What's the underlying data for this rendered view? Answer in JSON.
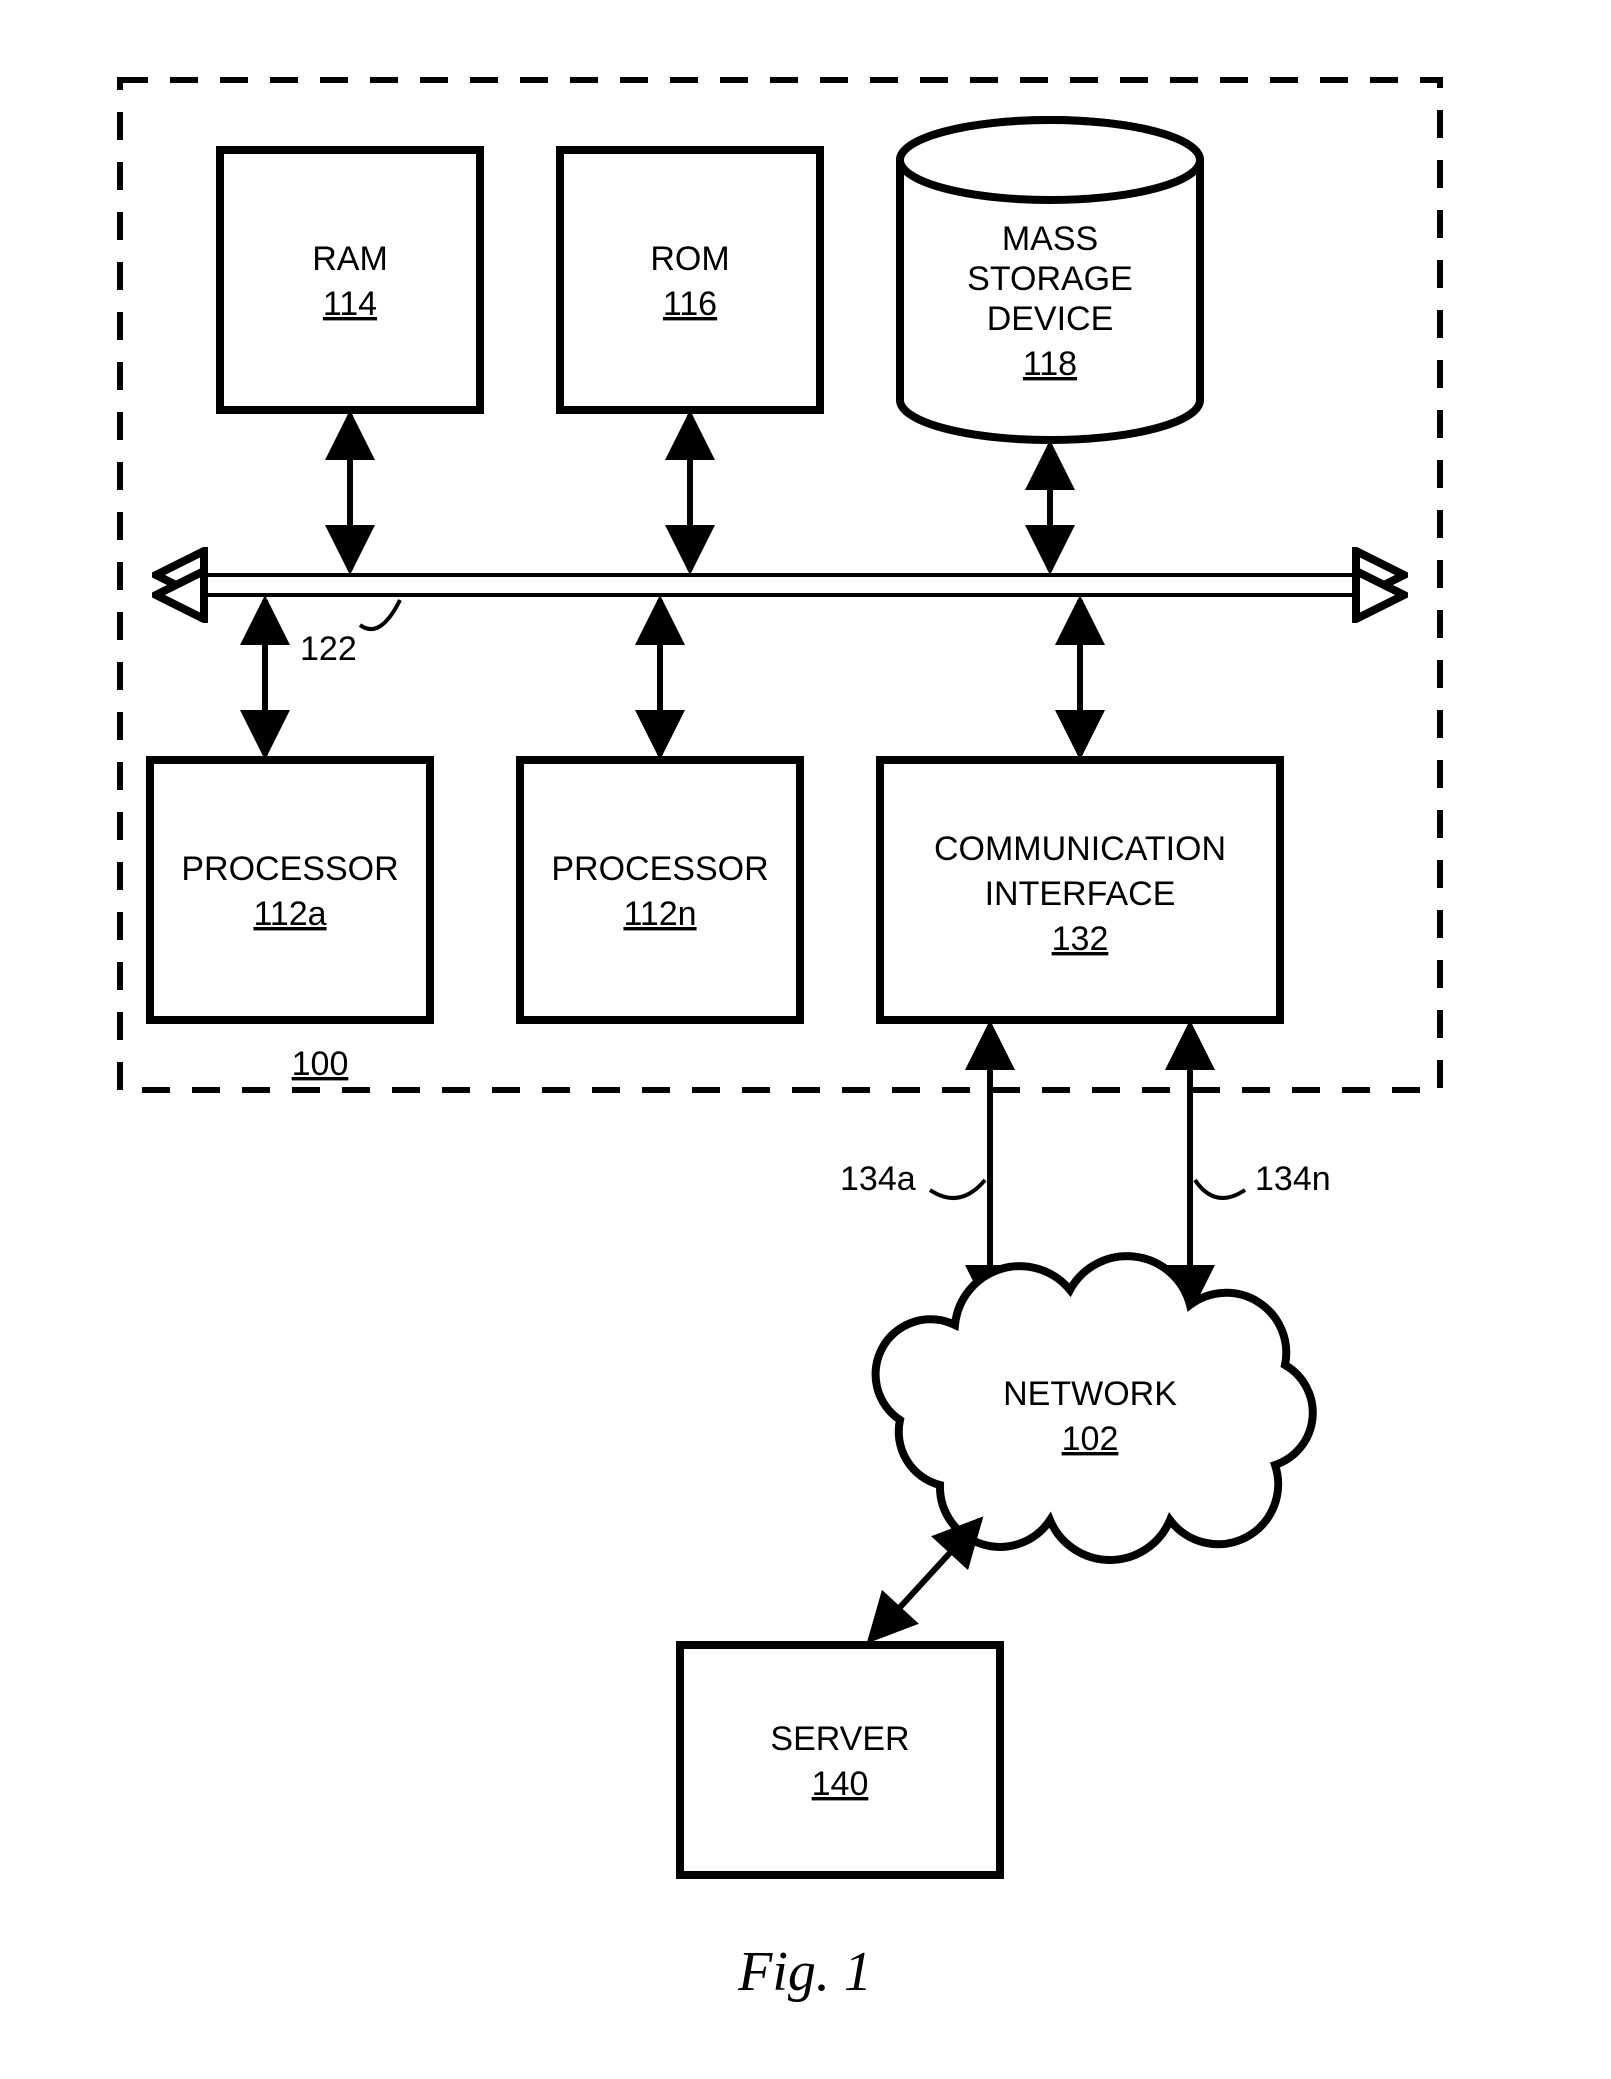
{
  "figure_caption": "Fig. 1",
  "system_ref": "100",
  "bus_ref": "122",
  "ram": {
    "label": "RAM",
    "ref": "114"
  },
  "rom": {
    "label": "ROM",
    "ref": "116"
  },
  "storage": {
    "line1": "MASS",
    "line2": "STORAGE",
    "line3": "DEVICE",
    "ref": "118"
  },
  "proc_a": {
    "label": "PROCESSOR",
    "ref": "112a"
  },
  "proc_n": {
    "label": "PROCESSOR",
    "ref": "112n"
  },
  "comm": {
    "line1": "COMMUNICATION",
    "line2": "INTERFACE",
    "ref": "132"
  },
  "link_a_ref": "134a",
  "link_n_ref": "134n",
  "network": {
    "label": "NETWORK",
    "ref": "102"
  },
  "server": {
    "label": "SERVER",
    "ref": "140"
  }
}
